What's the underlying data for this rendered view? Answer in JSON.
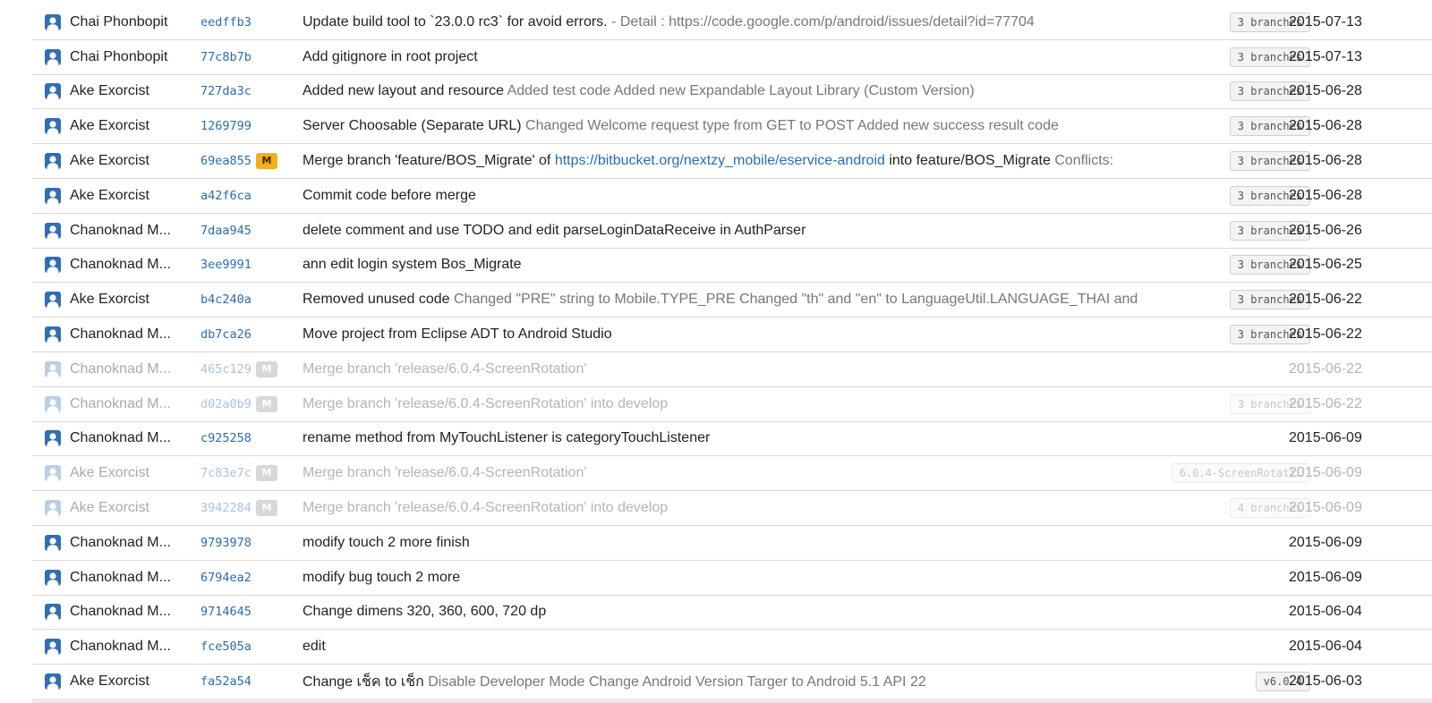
{
  "commits": [
    {
      "author": "Chai Phonbopit",
      "hash": "eedffb3",
      "merge": false,
      "main": "Update build tool to `23.0.0 rc3` for avoid errors.",
      "sub": " - Detail : https://code.google.com/p/android/issues/detail?id=77704",
      "link": "",
      "after": "",
      "tail": "",
      "branches": "3 branches",
      "date": "2015-07-13",
      "dim": false
    },
    {
      "author": "Chai Phonbopit",
      "hash": "77c8b7b",
      "merge": false,
      "main": "Add gitignore in root project",
      "sub": "",
      "link": "",
      "after": "",
      "tail": "",
      "branches": "3 branches",
      "date": "2015-07-13",
      "dim": false
    },
    {
      "author": "Ake Exorcist",
      "hash": "727da3c",
      "merge": false,
      "main": "Added new layout and resource",
      "sub": " Added test code Added new Expandable Layout Library (Custom Version)",
      "link": "",
      "after": "",
      "tail": "",
      "branches": "3 branches",
      "date": "2015-06-28",
      "dim": false
    },
    {
      "author": "Ake Exorcist",
      "hash": "1269799",
      "merge": false,
      "main": "Server Choosable (Separate URL)",
      "sub": " Changed Welcome request type from GET to POST Added new success result code",
      "link": "",
      "after": "",
      "tail": "",
      "branches": "3 branches",
      "date": "2015-06-28",
      "dim": false
    },
    {
      "author": "Ake Exorcist",
      "hash": "69ea855",
      "merge": true,
      "merge_label": "M",
      "main": "Merge branch 'feature/BOS_Migrate' of ",
      "sub": "",
      "link": "https://bitbucket.org/nextzy_mobile/eservice-android",
      "after": " into feature/BOS_Migrate",
      "tail": " Conflicts:",
      "branches": "3 branches",
      "date": "2015-06-28",
      "dim": false
    },
    {
      "author": "Ake Exorcist",
      "hash": "a42f6ca",
      "merge": false,
      "main": "Commit code before merge",
      "sub": "",
      "link": "",
      "after": "",
      "tail": "",
      "branches": "3 branches",
      "date": "2015-06-28",
      "dim": false
    },
    {
      "author": "Chanoknad M...",
      "hash": "7daa945",
      "merge": false,
      "main": "delete comment and use TODO and edit parseLoginDataReceive in AuthParser",
      "sub": "",
      "link": "",
      "after": "",
      "tail": "",
      "branches": "3 branches",
      "date": "2015-06-26",
      "dim": false
    },
    {
      "author": "Chanoknad M...",
      "hash": "3ee9991",
      "merge": false,
      "main": "ann edit login system Bos_Migrate",
      "sub": "",
      "link": "",
      "after": "",
      "tail": "",
      "branches": "3 branches",
      "date": "2015-06-25",
      "dim": false
    },
    {
      "author": "Ake Exorcist",
      "hash": "b4c240a",
      "merge": false,
      "main": "Removed unused code",
      "sub": " Changed \"PRE\" string to Mobile.TYPE_PRE Changed \"th\" and \"en\" to LanguageUtil.LANGUAGE_THAI and",
      "link": "",
      "after": "",
      "tail": "",
      "branches": "3 branches",
      "date": "2015-06-22",
      "dim": false
    },
    {
      "author": "Chanoknad M...",
      "hash": "db7ca26",
      "merge": false,
      "main": "Move project from Eclipse ADT to Android Studio",
      "sub": "",
      "link": "",
      "after": "",
      "tail": "",
      "branches": "3 branches",
      "date": "2015-06-22",
      "dim": false
    },
    {
      "author": "Chanoknad M...",
      "hash": "465c129",
      "merge": true,
      "merge_label": "M",
      "main": "Merge branch 'release/6.0.4-ScreenRotation'",
      "sub": "",
      "link": "",
      "after": "",
      "tail": "",
      "branches": "",
      "date": "2015-06-22",
      "dim": true
    },
    {
      "author": "Chanoknad M...",
      "hash": "d02a0b9",
      "merge": true,
      "merge_label": "M",
      "main": "Merge branch 'release/6.0.4-ScreenRotation' into develop",
      "sub": "",
      "link": "",
      "after": "",
      "tail": "",
      "branches": "3 branches",
      "date": "2015-06-22",
      "dim": true
    },
    {
      "author": "Chanoknad M...",
      "hash": "c925258",
      "merge": false,
      "main": "rename method from MyTouchListener is categoryTouchListener",
      "sub": "",
      "link": "",
      "after": "",
      "tail": "",
      "branches": "",
      "date": "2015-06-09",
      "dim": false
    },
    {
      "author": "Ake Exorcist",
      "hash": "7c83e7c",
      "merge": true,
      "merge_label": "M",
      "main": "Merge branch 'release/6.0.4-ScreenRotation'",
      "sub": "",
      "link": "",
      "after": "",
      "tail": "",
      "branches": "6.0.4-ScreenRotati…",
      "date": "2015-06-09",
      "dim": true
    },
    {
      "author": "Ake Exorcist",
      "hash": "3942284",
      "merge": true,
      "merge_label": "M",
      "main": "Merge branch 'release/6.0.4-ScreenRotation' into develop",
      "sub": "",
      "link": "",
      "after": "",
      "tail": "",
      "branches": "4 branches",
      "date": "2015-06-09",
      "dim": true
    },
    {
      "author": "Chanoknad M...",
      "hash": "9793978",
      "merge": false,
      "main": "modify touch 2 more finish",
      "sub": "",
      "link": "",
      "after": "",
      "tail": "",
      "branches": "",
      "date": "2015-06-09",
      "dim": false
    },
    {
      "author": "Chanoknad M...",
      "hash": "6794ea2",
      "merge": false,
      "main": "modify bug touch 2 more",
      "sub": "",
      "link": "",
      "after": "",
      "tail": "",
      "branches": "",
      "date": "2015-06-09",
      "dim": false
    },
    {
      "author": "Chanoknad M...",
      "hash": "9714645",
      "merge": false,
      "main": "Change dimens 320, 360, 600, 720 dp",
      "sub": "",
      "link": "",
      "after": "",
      "tail": "",
      "branches": "",
      "date": "2015-06-04",
      "dim": false
    },
    {
      "author": "Chanoknad M...",
      "hash": "fce505a",
      "merge": false,
      "main": "edit",
      "sub": "",
      "link": "",
      "after": "",
      "tail": "",
      "branches": "",
      "date": "2015-06-04",
      "dim": false
    },
    {
      "author": "Ake Exorcist",
      "hash": "fa52a54",
      "merge": false,
      "main": "Change เช็ค to เช็ก",
      "sub": " Disable Developer Mode Change Android Version Targer to Android 5.1 API 22",
      "link": "",
      "after": "",
      "tail": "",
      "branches": "v6.0.4",
      "date": "2015-06-03",
      "dim": false
    }
  ]
}
